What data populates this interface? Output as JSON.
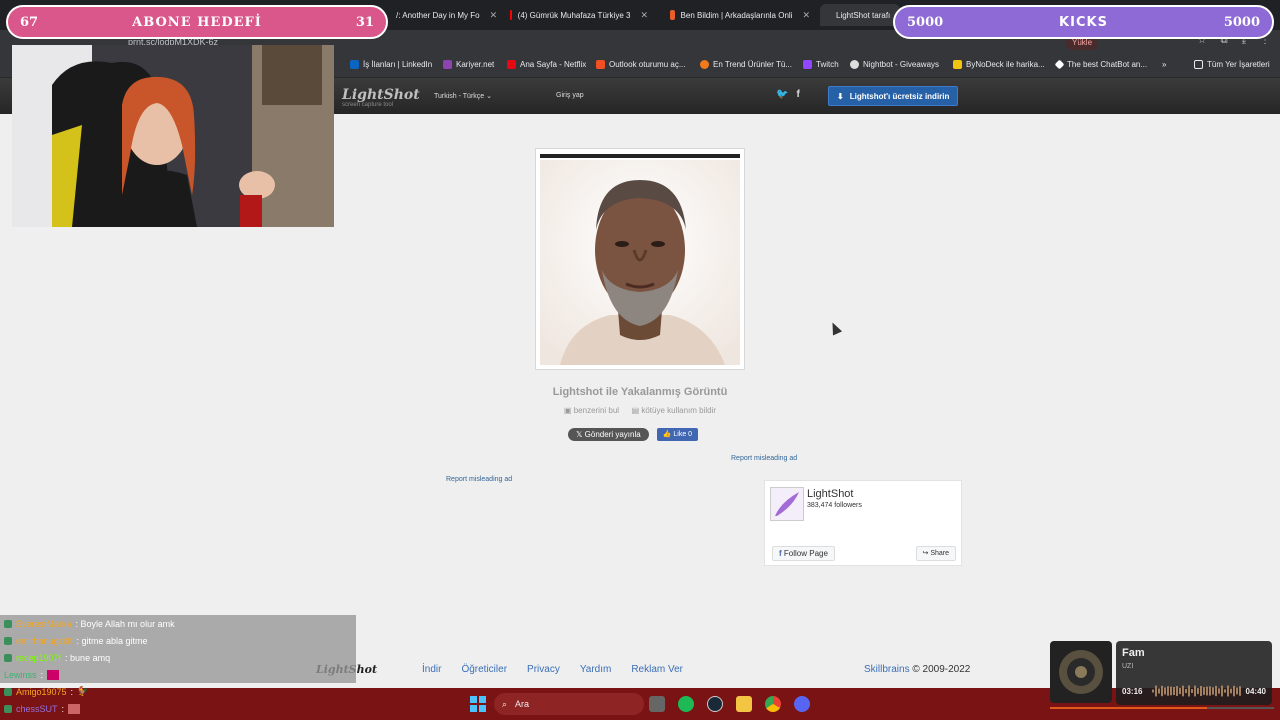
{
  "browser": {
    "tabs": [
      {
        "label": "/: Another Day in My Fo",
        "favicon_color": "#bbbbbb"
      },
      {
        "label": "(4) Gümrük Muhafaza Türkiye 3",
        "favicon_color": "#ff0000"
      },
      {
        "label": "Ben Bildim | Arkadaşlarınla Onli",
        "favicon_color": "#e85d2a"
      },
      {
        "label": "LightShot tarafı",
        "favicon_color": "#b678e0"
      }
    ],
    "url": "prnt.sc/lodpM1XDK-6z",
    "update_label": "Yükle",
    "bookmarks": [
      {
        "label": "İş İlanları | LinkedIn",
        "icon": "linkedin-icon",
        "color": "#0a66c2"
      },
      {
        "label": "Kariyer.net",
        "icon": "kariyer-icon",
        "color": "#8e44ad"
      },
      {
        "label": "Ana Sayfa - Netflix",
        "icon": "netflix-icon",
        "color": "#e50914"
      },
      {
        "label": "Outlook oturumu aç...",
        "icon": "microsoft-icon",
        "color": "#f25022"
      },
      {
        "label": "En Trend Ürünler Tü...",
        "icon": "trendyol-icon",
        "color": "#f27a1a"
      },
      {
        "label": "Twitch",
        "icon": "twitch-icon",
        "color": "#9146ff"
      },
      {
        "label": "Nightbot - Giveaways",
        "icon": "nightbot-icon",
        "color": "#dddddd"
      },
      {
        "label": "ByNoDeck ile harika...",
        "icon": "bynodeck-icon",
        "color": "#f1c40f"
      },
      {
        "label": "The best ChatBot an...",
        "icon": "chatbot-icon",
        "color": "#ffffff"
      },
      {
        "label": "»",
        "icon": "more-icon",
        "color": "#e8eaed"
      },
      {
        "label": "Tüm Yer İşaretleri",
        "icon": "folder-icon",
        "color": "#e8eaed"
      }
    ]
  },
  "lightshot": {
    "logo": "LightShot",
    "tagline": "screen capture tool",
    "language": "Turkish - Türkçe",
    "login": "Giriş yap",
    "download_button": "Lightshot'ı ücretsiz indirin",
    "caption": "Lightshot ile Yakalanmış Görüntü",
    "find_similar": "benzerini bul",
    "report_abuse": "kötüye kullanım bildir",
    "tweet_button": "Gönderi yayınla",
    "like_button": "Like 0",
    "report_ad_label": "Report misleading ad",
    "fb_page": {
      "name": "LightShot",
      "followers": "383,474 followers",
      "follow_label": "Follow Page",
      "share_label": "Share"
    },
    "footer": {
      "logo": "LightShot",
      "links": [
        "İndir",
        "Öğreticiler",
        "Privacy",
        "Yardım",
        "Reklam Ver"
      ],
      "company": "Skillbrains",
      "copyright": "© 2009-2022"
    }
  },
  "overlays": {
    "subscriber_goal": {
      "current": "67",
      "title": "ABONE HEDEFİ",
      "target": "31",
      "color": "#d9578a"
    },
    "kicks_goal": {
      "current": "5000",
      "title": "KICKS",
      "target": "5000",
      "color": "#8d6ad6"
    },
    "chat": [
      {
        "user": "EverestMarka",
        "user_color": "#f5a623",
        "message": ": Boyle Allah mı olur amk"
      },
      {
        "user": "emirhanugzkft",
        "user_color": "#f5a623",
        "message": ": gitme abla gitme"
      },
      {
        "user": "recep1907f",
        "user_color": "#7cfc00",
        "message": ": bune amq"
      },
      {
        "user": "Lewinss",
        "user_color": "#3cb371",
        "message": ":"
      },
      {
        "user": "Amigo19075",
        "user_color": "#f5a623",
        "message": ":"
      },
      {
        "user": "chessSUT",
        "user_color": "#9370db",
        "message": ":"
      }
    ],
    "music": {
      "title": "Fam",
      "artist": "UZI",
      "elapsed": "03:16",
      "duration": "04:40",
      "progress": 0.7
    }
  },
  "taskbar": {
    "search_placeholder": "Ara",
    "apps": [
      "windows-start-icon",
      "file-view-icon",
      "spotify-icon",
      "steam-icon",
      "file-explorer-icon",
      "chrome-icon",
      "discord-icon"
    ]
  }
}
